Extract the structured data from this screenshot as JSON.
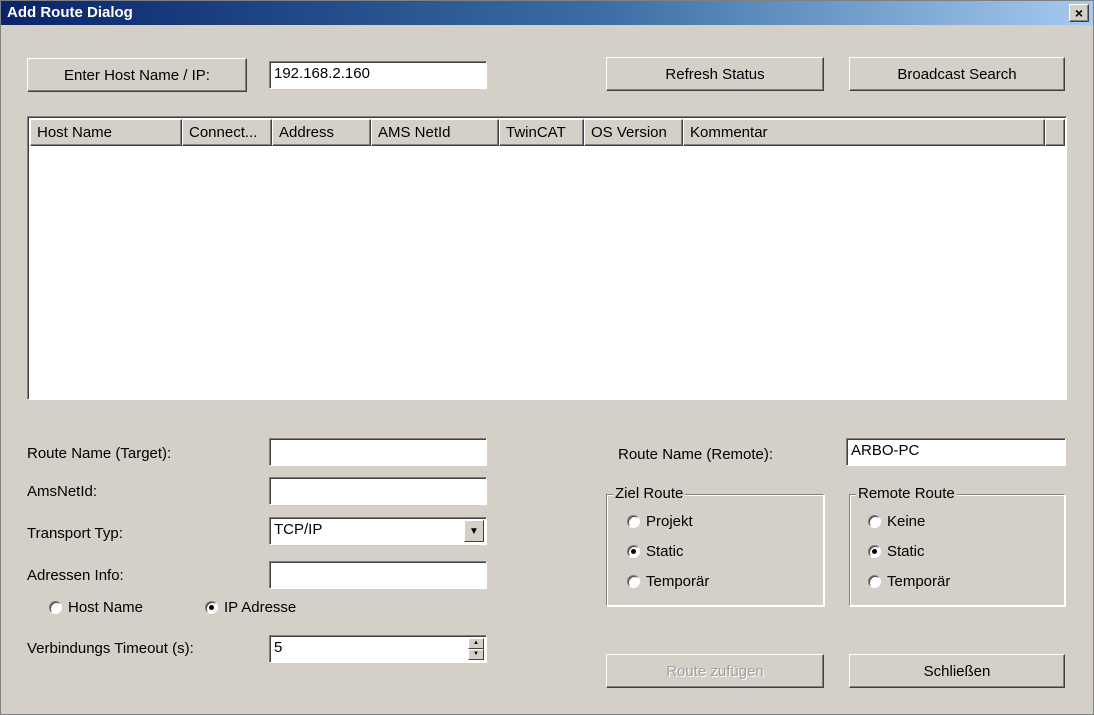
{
  "window": {
    "title": "Add Route Dialog",
    "close_glyph": "×",
    "colors": {
      "face": "#d4d0c8",
      "titlebar_start": "#0a246a",
      "titlebar_end": "#a6caf0"
    }
  },
  "toolbar": {
    "enter_host_label": "Enter Host Name / IP:",
    "host_ip_value": "192.168.2.160",
    "refresh_label": "Refresh Status",
    "broadcast_label": "Broadcast Search"
  },
  "table": {
    "columns": [
      "Host Name",
      "Connect...",
      "Address",
      "AMS NetId",
      "TwinCAT",
      "OS Version",
      "Kommentar",
      ""
    ],
    "rows": []
  },
  "left": {
    "route_name_target_label": "Route Name (Target):",
    "route_name_target_value": "",
    "amsnetid_label": "AmsNetId:",
    "amsnetid_value": "",
    "transport_label": "Transport Typ:",
    "transport_value": "TCP/IP",
    "adressen_label": "Adressen Info:",
    "adressen_value": "",
    "radio_host_name": "Host Name",
    "radio_ip_adresse": "IP Adresse",
    "timeout_label": "Verbindungs Timeout (s):",
    "timeout_value": "5"
  },
  "right": {
    "route_name_remote_label": "Route Name (Remote):",
    "route_name_remote_value": "ARBO-PC",
    "ziel_route": {
      "title": "Ziel Route",
      "options": [
        "Projekt",
        "Static",
        "Temporär"
      ],
      "selected": "Static"
    },
    "remote_route": {
      "title": "Remote Route",
      "options": [
        "Keine",
        "Static",
        "Temporär"
      ],
      "selected": "Static"
    }
  },
  "footer": {
    "add_route_label": "Route zufügen",
    "close_label": "Schließen"
  },
  "icons": {
    "dropdown": "combo-arrow-down-icon",
    "spin_up": "spin-up-icon",
    "spin_down": "spin-down-icon"
  }
}
